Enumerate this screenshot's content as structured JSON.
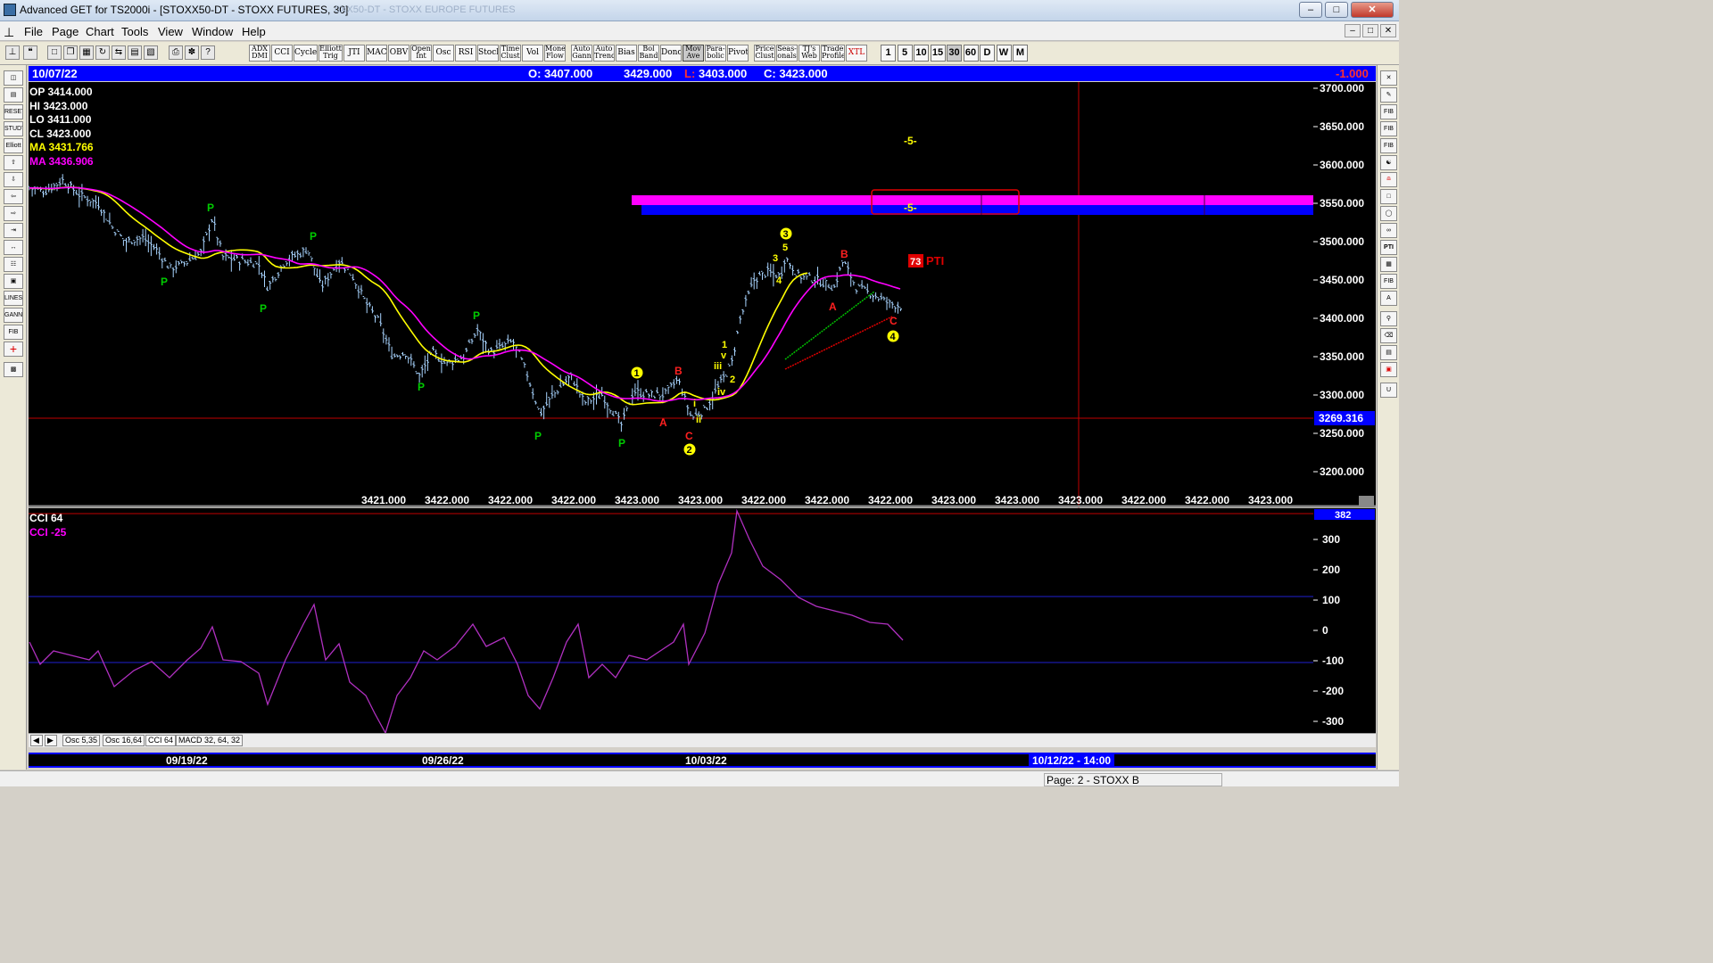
{
  "window": {
    "title": "Advanced GET for TS2000i - [STOXX50-DT - STOXX FUTURES, 30]",
    "ghost_title": "0XX50-DT - STOXX EUROPE FUTURES"
  },
  "menu": [
    "File",
    "Page",
    "Chart",
    "Tools",
    "View",
    "Window",
    "Help"
  ],
  "toolbar": {
    "studies": [
      [
        "ADX",
        "DMI"
      ],
      [
        "CCI"
      ],
      [
        "Cycles"
      ],
      [
        "Elliott",
        "Trig"
      ],
      [
        "JTI"
      ],
      [
        "MACD"
      ],
      [
        "OBV"
      ],
      [
        "Open",
        "Int"
      ],
      [
        "Osc"
      ],
      [
        "RSI"
      ],
      [
        "Stoch"
      ],
      [
        "Time",
        "Clust"
      ],
      [
        "Vol"
      ],
      [
        "Money",
        "Flow"
      ],
      [
        "Auto",
        "Gann"
      ],
      [
        "Auto",
        "Trend"
      ],
      [
        "Bias"
      ],
      [
        "Bol",
        "Band"
      ],
      [
        "Donch"
      ],
      [
        "Mov",
        "Ave"
      ],
      [
        "Para-",
        "bolic"
      ],
      [
        "Pivot"
      ],
      [
        "Price",
        "Clust"
      ],
      [
        "Seas-",
        "onals"
      ],
      [
        "TJ's",
        "Web"
      ],
      [
        "Trade",
        "Profile"
      ],
      [
        "XTL"
      ]
    ],
    "timeframes": [
      "1",
      "5",
      "10",
      "15",
      "30",
      "60",
      "D",
      "W",
      "M"
    ],
    "selected_timeframe": "30"
  },
  "header": {
    "date": "10/07/22",
    "open": "O: 3407.000",
    "high": "3429.000",
    "low_label": "L:",
    "low": "3403.000",
    "close": "C: 3423.000",
    "net": "-1.000"
  },
  "legend": {
    "op": "OP 3414.000",
    "hi": "HI  3423.000",
    "lo": "LO  3411.000",
    "cl": "CL  3423.000",
    "ma1": "MA  3431.766",
    "ma2": "MA  3436.906"
  },
  "price_axis": {
    "labels": [
      "3700.000",
      "3650.000",
      "3600.000",
      "3550.000",
      "3500.000",
      "3450.000",
      "3400.000",
      "3350.000",
      "3300.000",
      "3250.000",
      "3200.000"
    ],
    "cursor_price": "3269.316"
  },
  "bottom_values": [
    "3421.000",
    "3422.000",
    "3422.000",
    "3422.000",
    "3423.000",
    "3423.000",
    "3422.000",
    "3422.000",
    "3422.000",
    "3423.000",
    "3423.000",
    "3423.000",
    "3422.000",
    "3422.000",
    "3423.000"
  ],
  "annotations": {
    "pti_score": "73",
    "pti_label": "PTI",
    "target_top": "-5-",
    "target_band": "-5-",
    "p_label": "P",
    "waves": {
      "w1": "1",
      "w2": "2",
      "w3": "3",
      "w4": "4",
      "b5": "5",
      "b3": "3",
      "b4": "4",
      "A": "A",
      "B": "B",
      "C": "C",
      "i": "i",
      "ii": "ii",
      "iii": "iii",
      "iv": "iv",
      "v": "v",
      "s1": "1",
      "s2": "2"
    }
  },
  "cci_panel": {
    "label1": "CCI 64",
    "label2": "CCI  -25",
    "current": "382",
    "axis": [
      "300",
      "200",
      "100",
      "0",
      "-100",
      "-200",
      "-300"
    ]
  },
  "tabs": [
    "Osc 5,35",
    "Osc 16,64",
    "CCI 64",
    "MACD 32, 64, 32"
  ],
  "active_tab": "CCI 64",
  "dates": [
    "09/19/22",
    "09/26/22",
    "10/03/22"
  ],
  "cursor_date": "10/12/22 - 14:00",
  "status": "Page: 2 - STOXX B",
  "colors": {
    "price_bars": "#a8d4ff",
    "ma1": "#ffff00",
    "ma2": "#ff00ff",
    "zone_magenta": "#ff00ff",
    "zone_blue": "#0000ff",
    "p_label": "#00cc00",
    "wave": "#ffff00",
    "abc": "#ff2020",
    "cci": "#b030c0"
  }
}
